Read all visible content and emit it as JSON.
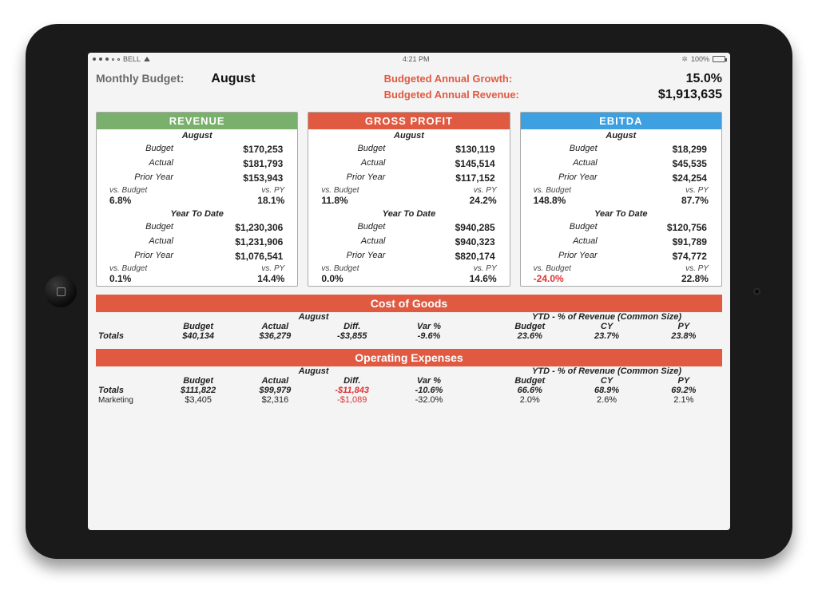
{
  "statusbar": {
    "carrier": "BELL",
    "time": "4:21 PM",
    "battery": "100%"
  },
  "header": {
    "title_label": "Monthly Budget:",
    "month": "August",
    "growth_label": "Budgeted Annual Growth:",
    "growth_value": "15.0%",
    "revenue_label": "Budgeted Annual Revenue:",
    "revenue_value": "$1,913,635"
  },
  "cards": {
    "period": "August",
    "ytd_label": "Year To Date",
    "row_labels": {
      "budget": "Budget",
      "actual": "Actual",
      "py": "Prior Year"
    },
    "var_labels": {
      "budget": "vs. Budget",
      "py": "vs. PY"
    },
    "revenue": {
      "title": "REVENUE",
      "month": {
        "budget": "$170,253",
        "actual": "$181,793",
        "py": "$153,943",
        "vs_budget": "6.8%",
        "vs_py": "18.1%"
      },
      "ytd": {
        "budget": "$1,230,306",
        "actual": "$1,231,906",
        "py": "$1,076,541",
        "vs_budget": "0.1%",
        "vs_py": "14.4%"
      }
    },
    "gross_profit": {
      "title": "GROSS PROFIT",
      "month": {
        "budget": "$130,119",
        "actual": "$145,514",
        "py": "$117,152",
        "vs_budget": "11.8%",
        "vs_py": "24.2%"
      },
      "ytd": {
        "budget": "$940,285",
        "actual": "$940,323",
        "py": "$820,174",
        "vs_budget": "0.0%",
        "vs_py": "14.6%"
      }
    },
    "ebitda": {
      "title": "EBITDA",
      "month": {
        "budget": "$18,299",
        "actual": "$45,535",
        "py": "$24,254",
        "vs_budget": "148.8%",
        "vs_py": "87.7%"
      },
      "ytd": {
        "budget": "$120,756",
        "actual": "$91,789",
        "py": "$74,772",
        "vs_budget": "-24.0%",
        "vs_py": "22.8%",
        "neg": true
      }
    }
  },
  "cogs": {
    "title": "Cost of Goods",
    "period": "August",
    "ytd_label": "YTD - % of Revenue (Common Size)",
    "cols": {
      "budget": "Budget",
      "actual": "Actual",
      "diff": "Diff.",
      "var": "Var %",
      "b2": "Budget",
      "cy": "CY",
      "py": "PY"
    },
    "totals_label": "Totals",
    "totals": {
      "budget": "$40,134",
      "actual": "$36,279",
      "diff": "-$3,855",
      "var": "-9.6%",
      "b2": "23.6%",
      "cy": "23.7%",
      "py": "23.8%"
    }
  },
  "opex": {
    "title": "Operating Expenses",
    "period": "August",
    "ytd_label": "YTD - % of Revenue (Common Size)",
    "cols": {
      "budget": "Budget",
      "actual": "Actual",
      "diff": "Diff.",
      "var": "Var %",
      "b2": "Budget",
      "cy": "CY",
      "py": "PY"
    },
    "totals_label": "Totals",
    "totals": {
      "budget": "$111,822",
      "actual": "$99,979",
      "diff": "-$11,843",
      "var": "-10.6%",
      "b2": "66.6%",
      "cy": "68.9%",
      "py": "69.2%"
    },
    "rows": [
      {
        "name": "Marketing",
        "budget": "$3,405",
        "actual": "$2,316",
        "diff": "-$1,089",
        "var": "-32.0%",
        "b2": "2.0%",
        "cy": "2.6%",
        "py": "2.1%"
      }
    ]
  }
}
